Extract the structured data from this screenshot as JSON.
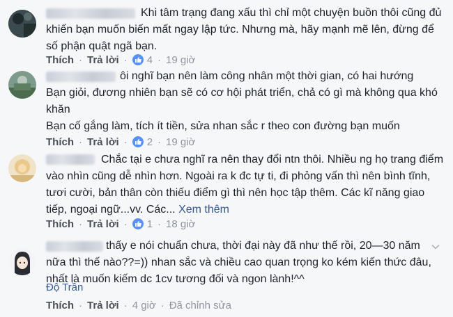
{
  "ui": {
    "like_label": "Thích",
    "reply_label": "Trả lời",
    "see_more": "Xem thêm",
    "edited_label": "Đã chỉnh sửa"
  },
  "comments": [
    {
      "lines": [
        "Khi tâm trạng đang xấu thì chỉ một chuyện buồn thôi cũng đủ",
        "khiến bạn muốn biến mất ngay lập tức. Nhưng mà, hãy mạnh mẽ lên, đừng để",
        "số phận quật ngã bạn."
      ],
      "likes": "4",
      "time": "19 giờ"
    },
    {
      "lines": [
        "ôi nghĩ bạn nên làm công nhân một thời gian, có hai hướng",
        "Bạn giỏi, đương nhiên bạn sẽ có cơ hội phát triển, chả có gì mà không qua khó",
        "khăn",
        "Bạn cố gắng làm, tích ít tiền, sửa nhan sắc r theo con đường bạn muốn"
      ],
      "likes": "2",
      "time": "19 giờ"
    },
    {
      "lines": [
        "Chắc tại e chưa nghĩ ra nên thay đổi ntn thôi. Nhiều ng họ trang điểm",
        "vào nhìn cũng dễ nhìn hơn. Ngoài ra k đc tự ti, đi phỏng vấn thì nên bình tĩnh,",
        "tươi cười, bản thân còn thiếu điểm gì thì nên học tập thêm. Các kĩ năng giao",
        "tiếp, ngoại ngữ...vv. Các..."
      ],
      "likes": "1",
      "time": "18 giờ"
    },
    {
      "lines": [
        "thấy e nói chuẩn chưa, thời đại này đã như thế rồi, 20—30 năm",
        "nữa thì thế nào??=)) nhan sắc và chiều cao quan trọng ko kém kiến thức đâu,",
        "nhất là muốn kiếm dc 1cv tương đối và ngon lành!^^"
      ],
      "author": "Độ Trần",
      "time": "4 giờ"
    }
  ]
}
